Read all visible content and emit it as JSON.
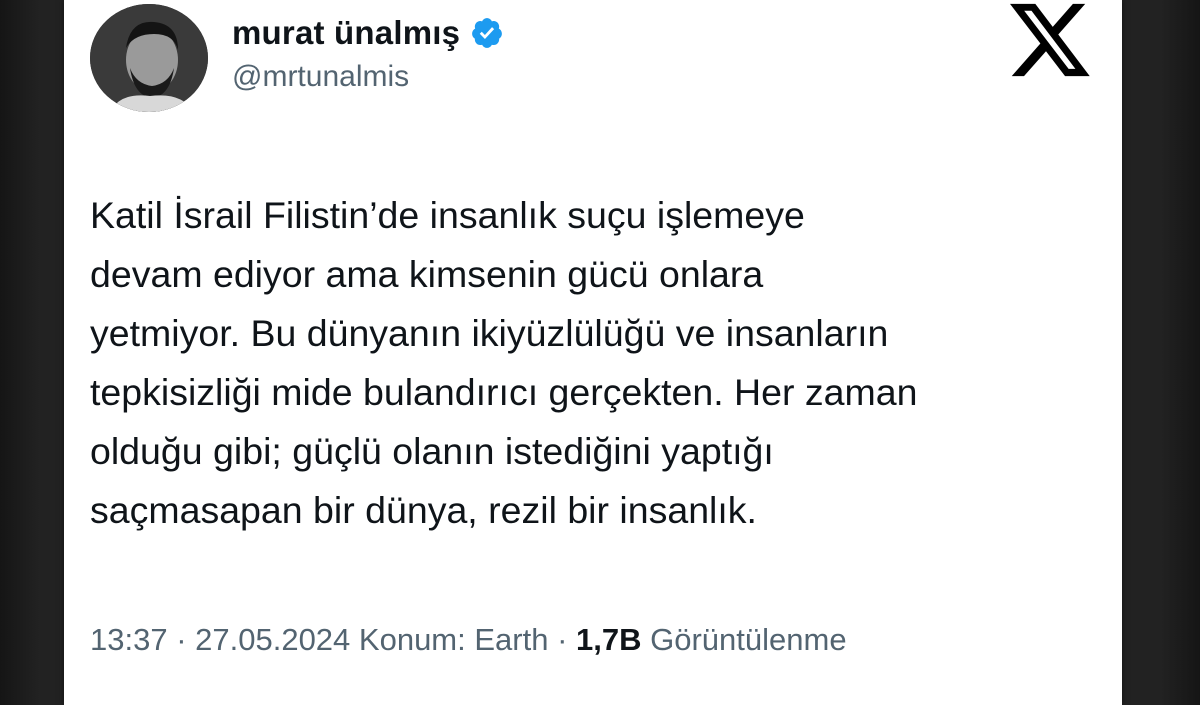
{
  "author": {
    "display_name": "murat ünalmış",
    "handle": "@mrtunalmis",
    "verified": true
  },
  "tweet": {
    "lines": [
      "Katil İsrail Filistin’de insanlık suçu işlemeye",
      "devam ediyor ama kimsenin gücü onlara",
      "yetmiyor. Bu dünyanın ikiyüzlülüğü ve insanların",
      "tepkisizliği mide bulandırıcı gerçekten. Her zaman",
      "olduğu gibi; güçlü olanın istediğini yaptığı",
      "saçmasapan bir dünya, rezil bir insanlık."
    ]
  },
  "meta": {
    "time": "13:37",
    "separator1": " · ",
    "date": "27.05.2024",
    "location": " Konum: Earth",
    "separator2": " · ",
    "views_count": "1,7B",
    "views_label": " Görüntülenme"
  },
  "colors": {
    "text": "#0f1419",
    "secondary": "#536471",
    "verified": "#1d9bf0"
  },
  "icons": {
    "brand": "x-logo-icon",
    "verified": "verified-badge-icon"
  }
}
